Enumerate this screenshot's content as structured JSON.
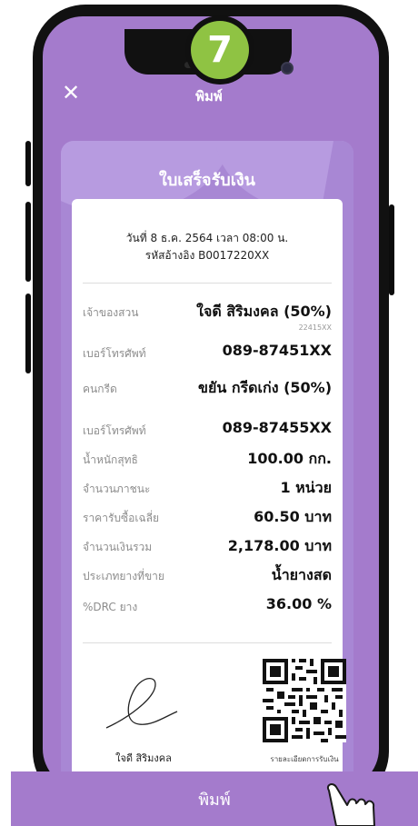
{
  "step": {
    "number": "7",
    "color": "#8fc343"
  },
  "header": {
    "title": "พิมพ์",
    "close_icon": "close-icon"
  },
  "receipt": {
    "title": "ใบเสร็จรับเงิน",
    "date_line": "วันที่ 8 ธ.ค. 2564 เวลา 08:00 น.",
    "ref_line": "รหัสอ้างอิง B0017220XX",
    "rows": [
      {
        "label": "เจ้าของสวน",
        "value": "ใจดี สิริมงคล (50%)",
        "note": "22415XX"
      },
      {
        "label": "เบอร์โทรศัพท์",
        "value": "089-87451XX"
      },
      {
        "label": "คนกรีด",
        "value": "ขยัน กรีดเก่ง (50%)"
      },
      {
        "label": "เบอร์โทรศัพท์",
        "value": "089-87455XX"
      },
      {
        "label": "น้ำหนักสุทธิ",
        "value": "100.00 กก."
      },
      {
        "label": "จำนวนภาชนะ",
        "value": "1 หน่วย"
      },
      {
        "label": "ราคารับซื้อเฉลี่ย",
        "value": "60.50 บาท"
      },
      {
        "label": "จำนวนเงินรวม",
        "value": "2,178.00 บาท"
      },
      {
        "label": "ประเภทยางที่ขาย",
        "value": "น้ำยางสด"
      },
      {
        "label": "%DRC ยาง",
        "value": "36.00 %"
      }
    ],
    "signature_name": "ใจดี สิริมงคล",
    "qr_caption": "รายละเอียดการรับเงิน"
  },
  "footer": {
    "print_label": "พิมพ์"
  },
  "colors": {
    "primary": "#a47bcc",
    "card": "#a887d4"
  }
}
